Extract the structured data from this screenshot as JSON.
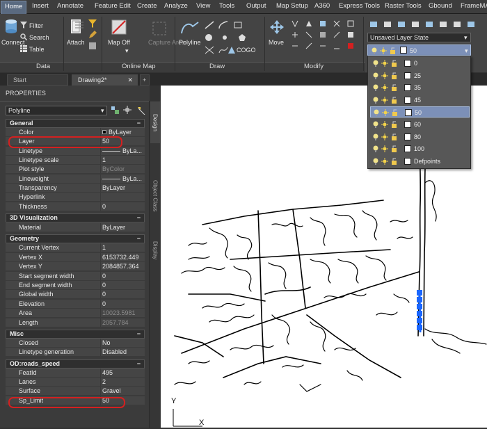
{
  "menu_tabs": [
    "Home",
    "Insert",
    "Annotate",
    "Feature Edit",
    "Create",
    "Analyze",
    "View",
    "Tools",
    "Output",
    "Map Setup",
    "A360",
    "Express Tools",
    "Raster Tools",
    "Gbound",
    "FrameMA"
  ],
  "ribbon": {
    "data_panel": {
      "label": "Data",
      "connect": "Connect",
      "filter": "Filter",
      "search": "Search",
      "table": "Table",
      "attach": "Attach"
    },
    "online_panel": {
      "label": "Online Map",
      "map_off": "Map Off",
      "capture_area": "Capture Area"
    },
    "draw_panel": {
      "label": "Draw",
      "polyline": "Polyline",
      "cogo": "COGO"
    },
    "modify_panel": {
      "label": "Modify",
      "move": "Move"
    },
    "layer_state": "Unsaved Layer State",
    "current_layer": "50"
  },
  "layer_list": [
    {
      "name": "0",
      "selected": false
    },
    {
      "name": "25",
      "selected": false
    },
    {
      "name": "35",
      "selected": false
    },
    {
      "name": "45",
      "selected": false
    },
    {
      "name": "50",
      "selected": true
    },
    {
      "name": "60",
      "selected": false
    },
    {
      "name": "80",
      "selected": false
    },
    {
      "name": "100",
      "selected": false
    },
    {
      "name": "Defpoints",
      "selected": false
    }
  ],
  "file_tabs": {
    "start": "Start",
    "drawing": "Drawing2*",
    "add": "+"
  },
  "properties": {
    "title": "PROPERTIES",
    "object_type": "Polyline",
    "side_tabs": [
      "Design",
      "Object Class",
      "Display"
    ],
    "sections": [
      {
        "name": "General",
        "rows": [
          {
            "k": "Color",
            "v": "ByLayer"
          },
          {
            "k": "Layer",
            "v": "50"
          },
          {
            "k": "Linetype",
            "v": "ByLa..."
          },
          {
            "k": "Linetype scale",
            "v": "1"
          },
          {
            "k": "Plot style",
            "v": "ByColor"
          },
          {
            "k": "Lineweight",
            "v": "ByLa..."
          },
          {
            "k": "Transparency",
            "v": "ByLayer"
          },
          {
            "k": "Hyperlink",
            "v": ""
          },
          {
            "k": "Thickness",
            "v": "0"
          }
        ]
      },
      {
        "name": "3D Visualization",
        "rows": [
          {
            "k": "Material",
            "v": "ByLayer"
          }
        ]
      },
      {
        "name": "Geometry",
        "rows": [
          {
            "k": "Current Vertex",
            "v": "1"
          },
          {
            "k": "Vertex X",
            "v": "6153732.449"
          },
          {
            "k": "Vertex Y",
            "v": "2084857.364"
          },
          {
            "k": "Start segment width",
            "v": "0"
          },
          {
            "k": "End segment width",
            "v": "0"
          },
          {
            "k": "Global width",
            "v": "0"
          },
          {
            "k": "Elevation",
            "v": "0"
          },
          {
            "k": "Area",
            "v": "10023.5981"
          },
          {
            "k": "Length",
            "v": "2057.784"
          }
        ]
      },
      {
        "name": "Misc",
        "rows": [
          {
            "k": "Closed",
            "v": "No"
          },
          {
            "k": "Linetype generation",
            "v": "Disabled"
          }
        ]
      },
      {
        "name": "OD:roads_speed",
        "rows": [
          {
            "k": "FeatId",
            "v": "495"
          },
          {
            "k": "Lanes",
            "v": "2"
          },
          {
            "k": "Surface",
            "v": "Gravel"
          },
          {
            "k": "Sp_Limit",
            "v": "50"
          }
        ]
      }
    ]
  },
  "ucs": {
    "y": "Y",
    "x": "X"
  },
  "colors": {
    "highlight": "#d42020",
    "selection": "#1a66ff",
    "accent": "#5a6a80"
  }
}
